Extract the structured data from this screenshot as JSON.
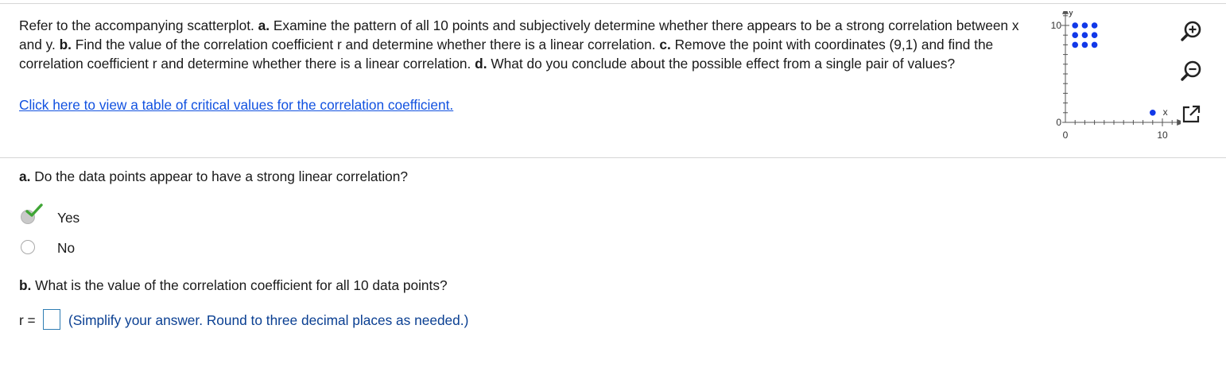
{
  "problem": {
    "intro": "Refer to the accompanying scatterplot.",
    "part_a_label": "a.",
    "part_a_text": "Examine the pattern of all 10 points and subjectively determine whether there appears to be a strong correlation between x and y.",
    "part_b_label": "b.",
    "part_b_text": "Find the value of the correlation coefficient r and determine whether there is a linear correlation.",
    "part_c_label": "c.",
    "part_c_text": "Remove the point with coordinates (9,1) and find the correlation coefficient r and determine whether there is a linear correlation.",
    "part_d_label": "d.",
    "part_d_text": "What do you conclude about the possible effect from a single pair of values?",
    "link_text": "Click here to view a table of critical values for the correlation coefficient."
  },
  "chart_data": {
    "type": "scatter",
    "x_axis_label": "x",
    "y_axis_label": "y",
    "x_ticks_labeled": [
      "0",
      "10"
    ],
    "y_ticks_labeled": [
      "0",
      "10"
    ],
    "xlim": [
      0,
      11
    ],
    "ylim": [
      0,
      11
    ],
    "point_color": "#1238e8",
    "points": [
      {
        "x": 1,
        "y": 10
      },
      {
        "x": 2,
        "y": 10
      },
      {
        "x": 3,
        "y": 10
      },
      {
        "x": 1,
        "y": 9
      },
      {
        "x": 2,
        "y": 9
      },
      {
        "x": 3,
        "y": 9
      },
      {
        "x": 1,
        "y": 8
      },
      {
        "x": 2,
        "y": 8
      },
      {
        "x": 3,
        "y": 8
      },
      {
        "x": 9,
        "y": 1
      }
    ]
  },
  "tools": {
    "zoom_in_icon": "zoom-in-icon",
    "zoom_out_icon": "zoom-out-icon",
    "popout_icon": "external-window-icon"
  },
  "question_a": {
    "label": "a.",
    "text": "Do the data points appear to have a strong linear correlation?",
    "options": [
      {
        "label": "Yes",
        "selected": true
      },
      {
        "label": "No",
        "selected": false
      }
    ],
    "correct_mark_color": "#3fa535"
  },
  "question_b": {
    "label": "b.",
    "text": "What is the value of the correlation coefficient for all 10 data points?",
    "r_prefix": "r =",
    "input_value": "",
    "hint": "(Simplify your answer. Round to three decimal places as needed.)"
  }
}
